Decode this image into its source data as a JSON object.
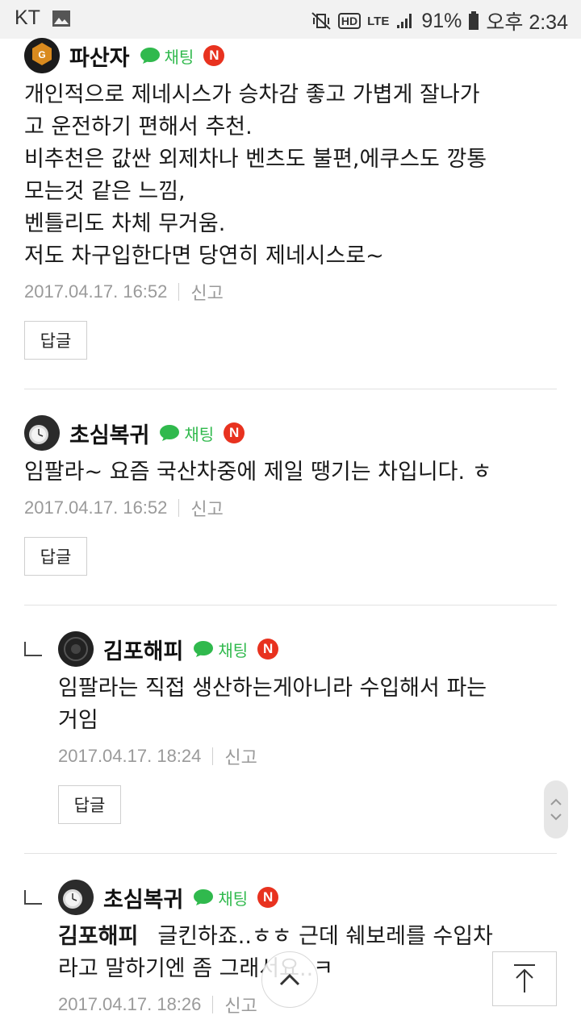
{
  "status_bar": {
    "carrier": "KT",
    "network": "LTE",
    "hd": "HD",
    "battery": "91%",
    "time": "오후 2:34"
  },
  "comments": [
    {
      "nickname": "파산자",
      "chat_label": "채팅",
      "badge": "N",
      "body": "개인적으로 제네시스가 승차감 좋고 가볍게 잘나가\n고 운전하기 편해서 추천.\n비추천은 값싼 외제차나 벤츠도 불편,에쿠스도 깡통\n모는것 같은 느낌,\n벤틀리도 차체 무거움.\n저도 차구입한다면 당연히 제네시스로~",
      "date": "2017.04.17. 16:52",
      "report": "신고",
      "reply_label": "답글"
    },
    {
      "nickname": "초심복귀",
      "chat_label": "채팅",
      "badge": "N",
      "body": "임팔라~ 요즘 국산차중에 제일 땡기는 차입니다. ㅎ",
      "date": "2017.04.17. 16:52",
      "report": "신고",
      "reply_label": "답글"
    },
    {
      "nickname": "김포해피",
      "chat_label": "채팅",
      "badge": "N",
      "body": "임팔라는 직접 생산하는게아니라 수입해서 파는\n거임",
      "date": "2017.04.17. 18:24",
      "report": "신고",
      "reply_label": "답글"
    },
    {
      "nickname": "초심복귀",
      "chat_label": "채팅",
      "badge": "N",
      "mention": "김포해피",
      "body": "글킨하죠..ㅎㅎ 근데 쉐보레를 수입차\n라고 말하기엔 좀 그래서요..ㅋ",
      "date": "2017.04.17. 18:26",
      "report": "신고"
    }
  ],
  "colors": {
    "chat_green": "#30b94d",
    "badge_red": "#e8321f"
  }
}
